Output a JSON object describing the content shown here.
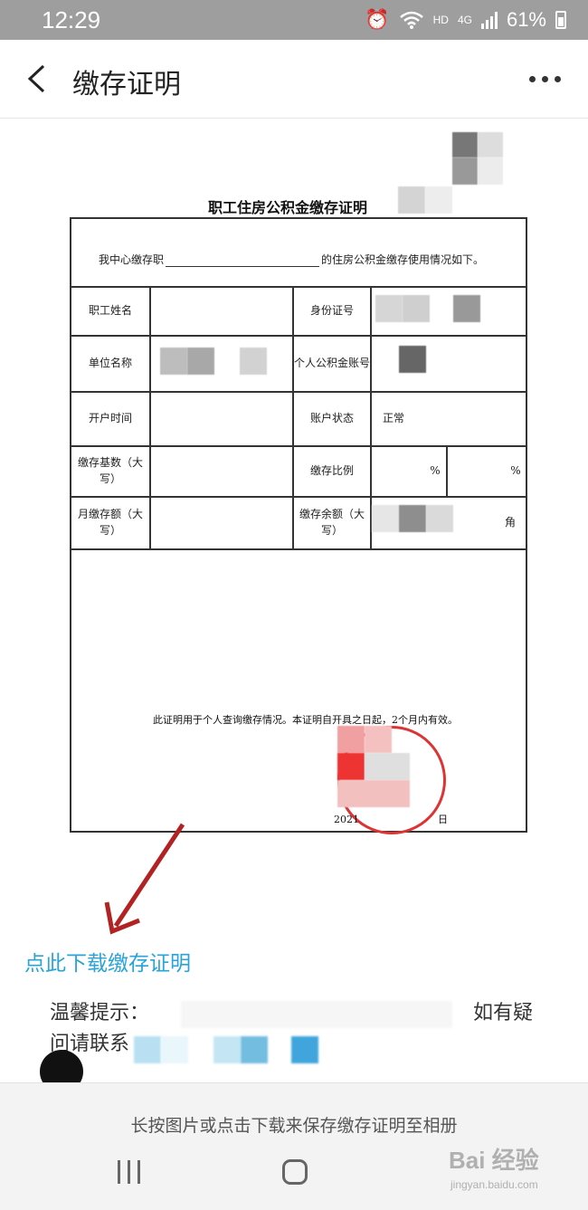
{
  "status_bar": {
    "time": "12:29",
    "hd_label": "HD",
    "network_label": "4G",
    "battery": "61%"
  },
  "header": {
    "title": "缴存证明",
    "back_icon": "chevron-left-icon",
    "more_icon": "more-horizontal-icon"
  },
  "certificate": {
    "title": "职工住房公积金缴存证明",
    "intro_prefix": "我中心缴存职",
    "intro_suffix": "的住房公积金缴存使用情况如下。",
    "labels": {
      "name": "职工姓名",
      "id_number": "身份证号",
      "employer": "单位名称",
      "account_no": "个人公积金账号",
      "open_time": "开户时间",
      "account_status": "账户状态",
      "base": "缴存基数（大写）",
      "ratio": "缴存比例",
      "monthly": "月缴存额（大写）",
      "balance": "缴存余额（大写）"
    },
    "values": {
      "account_status": "正常",
      "ratio_unit_1": "%",
      "ratio_unit_2": "%",
      "balance_unit": "角"
    },
    "notice": "此证明用于个人查询缴存情况。本证明自开具之日起，2个月内有效。",
    "date_prefix": "2021",
    "date_suffix": "日"
  },
  "download_link": "点此下载缴存证明",
  "tip": {
    "prefix": "温馨提示：",
    "right": "如有疑",
    "line2": "问请联系"
  },
  "bottom_bar": {
    "hint": "长按图片或点击下载来保存缴存证明至相册"
  },
  "watermark": {
    "text": "Bai 经验",
    "sub": "jingyan.baidu.com"
  },
  "colors": {
    "accent": "#2aa3d8",
    "status_bar": "#9e9e9e",
    "stamp_red": "#d33333",
    "arrow": "#b22222"
  }
}
